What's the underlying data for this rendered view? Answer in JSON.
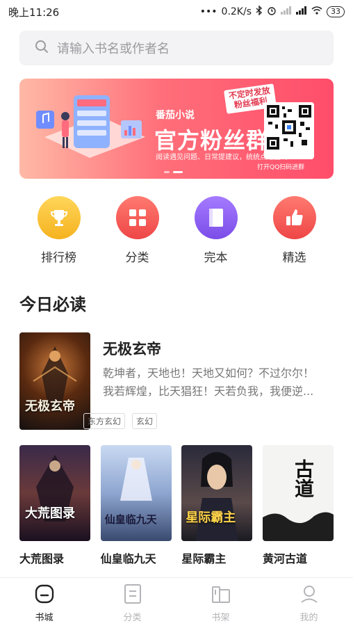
{
  "status_bar": {
    "time": "晚上11:26",
    "dots": "•••",
    "speed": "0.2K/s",
    "battery": "33"
  },
  "search": {
    "placeholder": "请输入书名或作者名"
  },
  "banner": {
    "subtitle": "番茄小说",
    "title": "官方粉丝群",
    "badge_line1": "不定时发放",
    "badge_line2": "粉丝福利",
    "note": "阅读遇见问题、日常提建议，统统点这里哟",
    "qr_caption": "打开QQ扫码进群"
  },
  "categories": [
    {
      "label": "排行榜",
      "icon": "trophy-icon",
      "color": "#f7c23a"
    },
    {
      "label": "分类",
      "icon": "grid-icon",
      "color": "#f0534f"
    },
    {
      "label": "完本",
      "icon": "book-icon",
      "color": "#8a5cf0"
    },
    {
      "label": "精选",
      "icon": "thumbs-up-icon",
      "color": "#f0534f"
    }
  ],
  "section": {
    "title": "今日必读"
  },
  "featured": {
    "title": "无极玄帝",
    "description_line1": "乾坤者，天地也！天地又如何？不过尔尔！",
    "description_line2": "我若辉煌，比天猖狂！天若负我，我便逆...",
    "tags": [
      "东方玄幻",
      "玄幻"
    ],
    "cover_text": "无极玄帝"
  },
  "books": [
    {
      "title": "大荒图录",
      "cover_text": "大荒图录"
    },
    {
      "title": "仙皇临九天",
      "cover_text": "仙皇临九天"
    },
    {
      "title": "星际霸主",
      "cover_text": "星际霸主"
    },
    {
      "title": "黄河古道",
      "cover_text": "古道"
    }
  ],
  "tabbar": {
    "tabs": [
      {
        "label": "书城",
        "icon": "bookstore-icon",
        "active": true
      },
      {
        "label": "分类",
        "icon": "category-icon",
        "active": false
      },
      {
        "label": "书架",
        "icon": "bookshelf-icon",
        "active": false
      },
      {
        "label": "我的",
        "icon": "profile-icon",
        "active": false
      }
    ]
  }
}
